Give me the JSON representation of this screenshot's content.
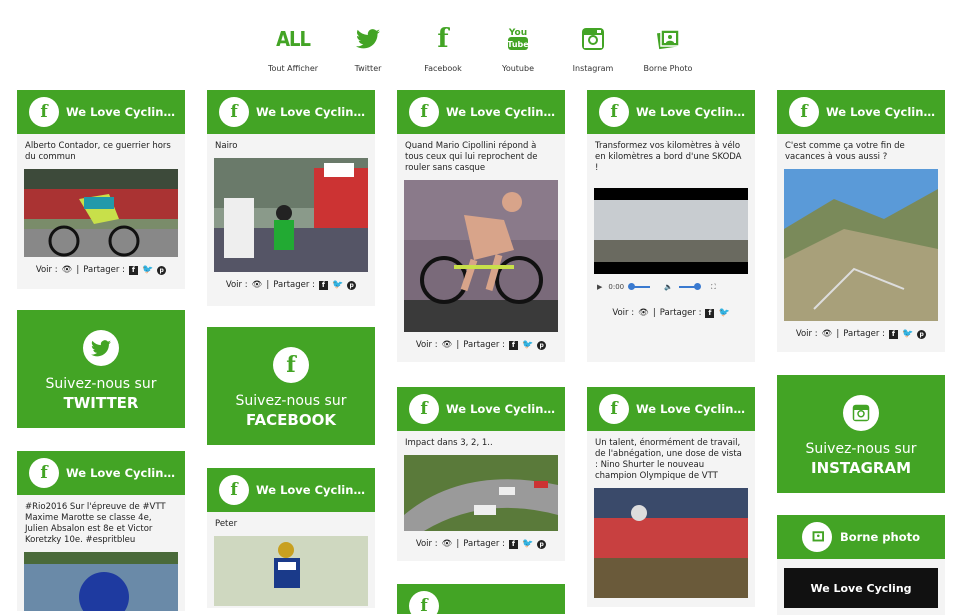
{
  "filters": [
    {
      "label": "Tout Afficher",
      "glyph": "ALL"
    },
    {
      "label": "Twitter",
      "glyph": "twitter"
    },
    {
      "label": "Facebook",
      "glyph": "f"
    },
    {
      "label": "Youtube",
      "glyph": "youtube"
    },
    {
      "label": "Instagram",
      "glyph": "instagram"
    },
    {
      "label": "Borne Photo",
      "glyph": "photo"
    }
  ],
  "colors": {
    "accent": "#43a425"
  },
  "shared": {
    "source_title": "We Love Cycling Fr...",
    "see_label": "Voir :",
    "share_label": "Partager :",
    "sep": "|"
  },
  "cards": {
    "c1": {
      "text": "Alberto Contador, ce guerrier hors du commun"
    },
    "c2": {
      "text": "Nairo"
    },
    "c3": {
      "text": "Quand Mario Cipollini répond à tous ceux qui lui reprochent de rouler sans casque"
    },
    "c4": {
      "text": "Transformez vos kilomètres à vélo en kilomètres a bord d'une SKODA !",
      "time": "0:00"
    },
    "c5": {
      "text": "C'est comme ça votre fin de vacances à vous aussi ?"
    },
    "c6": {
      "text": "#Rio2016 Sur l'épreuve de #VTT Maxime Marotte se classe 4e, Julien Absalon est 8e et Victor Koretzky 10e. #espritbleu"
    },
    "c7": {
      "text": "Peter"
    },
    "c8": {
      "text": "Impact dans 3, 2, 1.."
    },
    "c9": {
      "text": "Un talent, énormément de travail, de l'abnégation, une dose de vista : Nino Shurter le nouveau champion Olympique de VTT"
    }
  },
  "follow": {
    "twitter": {
      "line1": "Suivez-nous sur",
      "line2": "TWITTER"
    },
    "facebook": {
      "line1": "Suivez-nous sur",
      "line2": "FACEBOOK"
    },
    "instagram": {
      "line1": "Suivez-nous sur",
      "line2": "INSTAGRAM"
    }
  },
  "borne": {
    "title": "Borne photo",
    "logo_text": "We Love Cycling"
  }
}
